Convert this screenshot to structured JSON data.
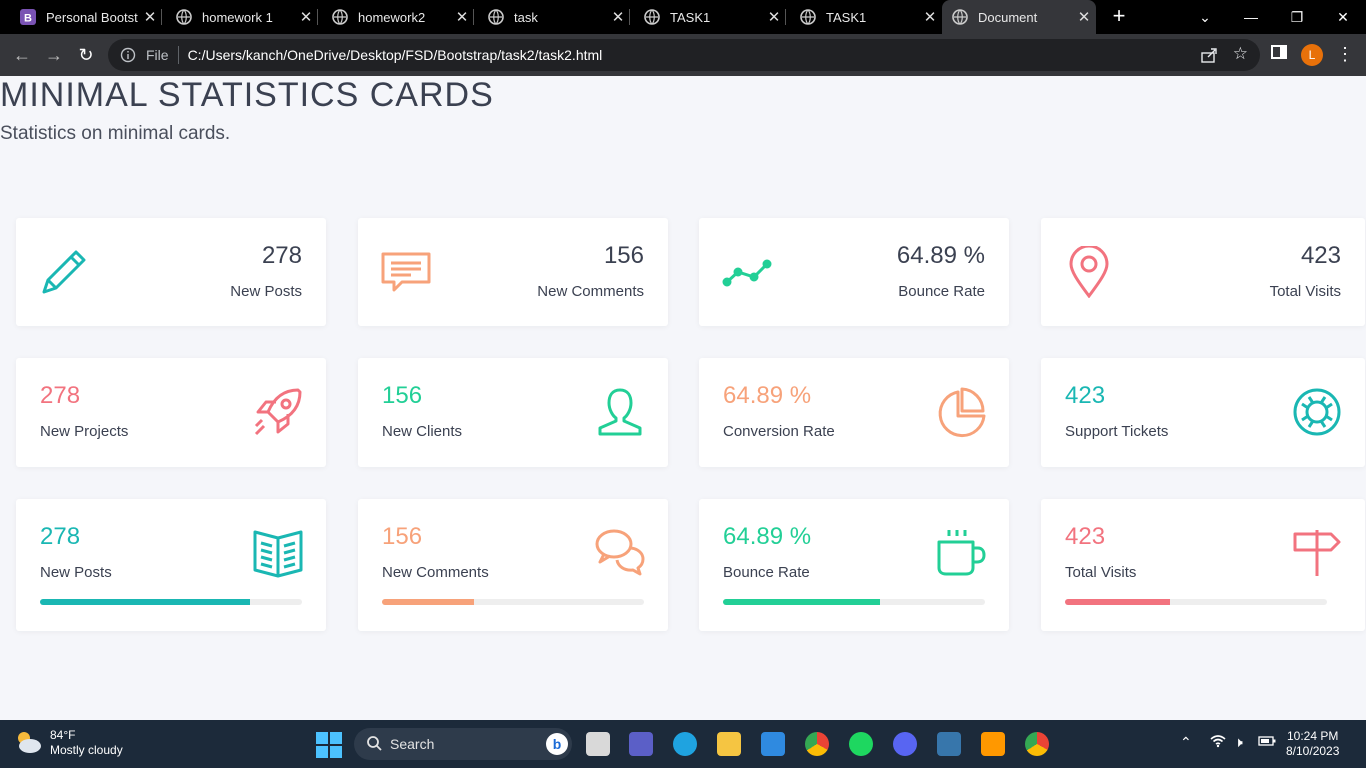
{
  "browser": {
    "tabs": [
      {
        "title": "Personal Bootstrap",
        "favicon": "bootstrap-icon",
        "active": false
      },
      {
        "title": "homework 1",
        "favicon": "globe-icon",
        "active": false
      },
      {
        "title": "homework2",
        "favicon": "globe-icon",
        "active": false
      },
      {
        "title": "task",
        "favicon": "globe-icon",
        "active": false
      },
      {
        "title": "TASK1",
        "favicon": "globe-icon",
        "active": false
      },
      {
        "title": "TASK1",
        "favicon": "globe-icon",
        "active": false
      },
      {
        "title": "Document",
        "favicon": "globe-icon",
        "active": true
      }
    ],
    "address": {
      "scheme_label": "File",
      "url": "C:/Users/kanch/OneDrive/Desktop/FSD/Bootstrap/task2/task2.html"
    },
    "profile_initial": "L"
  },
  "page": {
    "title": "MINIMAL STATISTICS CARDS",
    "subtitle": "Statistics on minimal cards.",
    "colors": {
      "teal": "#1ab7b3",
      "orange": "#f7a27a",
      "green": "#22cf96",
      "pink": "#f2737f",
      "text": "#3b4151"
    },
    "rows": [
      [
        {
          "value": "278",
          "label": "New Posts",
          "icon": "pencil-icon",
          "color": "#1ab7b3"
        },
        {
          "value": "156",
          "label": "New Comments",
          "icon": "speech-bubble-icon",
          "color": "#f7a27a"
        },
        {
          "value": "64.89 %",
          "label": "Bounce Rate",
          "icon": "trend-line-icon",
          "color": "#22cf96"
        },
        {
          "value": "423",
          "label": "Total Visits",
          "icon": "map-pin-icon",
          "color": "#f2737f"
        }
      ],
      [
        {
          "value": "278",
          "label": "New Projects",
          "icon": "rocket-icon",
          "color": "#f2737f"
        },
        {
          "value": "156",
          "label": "New Clients",
          "icon": "user-icon",
          "color": "#22cf96"
        },
        {
          "value": "64.89 %",
          "label": "Conversion Rate",
          "icon": "pie-chart-icon",
          "color": "#f7a27a"
        },
        {
          "value": "423",
          "label": "Support Tickets",
          "icon": "life-buoy-icon",
          "color": "#1ab7b3"
        }
      ],
      [
        {
          "value": "278",
          "label": "New Posts",
          "icon": "book-icon",
          "color": "#1ab7b3",
          "progress": 0.8
        },
        {
          "value": "156",
          "label": "New Comments",
          "icon": "chat-bubbles-icon",
          "color": "#f7a27a",
          "progress": 0.35
        },
        {
          "value": "64.89 %",
          "label": "Bounce Rate",
          "icon": "coffee-cup-icon",
          "color": "#22cf96",
          "progress": 0.6
        },
        {
          "value": "423",
          "label": "Total Visits",
          "icon": "signpost-icon",
          "color": "#f2737f",
          "progress": 0.4
        }
      ]
    ]
  },
  "taskbar": {
    "weather": {
      "temperature": "84°F",
      "condition": "Mostly cloudy"
    },
    "search_label": "Search",
    "time": "10:24 PM",
    "date": "8/10/2023"
  }
}
